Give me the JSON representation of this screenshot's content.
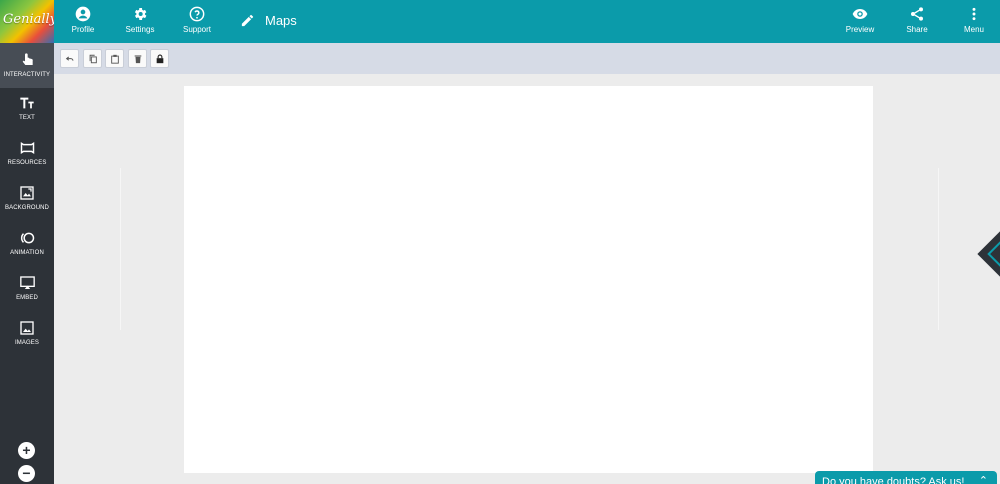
{
  "brand": {
    "logo_text": "Genially"
  },
  "topbar": {
    "profile_label": "Profile",
    "settings_label": "Settings",
    "support_label": "Support",
    "title": "Maps",
    "preview_label": "Preview",
    "share_label": "Share",
    "menu_label": "Menu"
  },
  "sidebar": {
    "items": [
      {
        "label": "INTERACTIVITY",
        "icon": "touch-icon"
      },
      {
        "label": "TEXT",
        "icon": "text-icon"
      },
      {
        "label": "RESOURCES",
        "icon": "resources-icon"
      },
      {
        "label": "BACKGROUND",
        "icon": "background-icon"
      },
      {
        "label": "ANIMATION",
        "icon": "animation-icon"
      },
      {
        "label": "EMBED",
        "icon": "embed-icon"
      },
      {
        "label": "IMAGES",
        "icon": "image-icon"
      }
    ],
    "zoom_in": "+",
    "zoom_out": "−"
  },
  "toolbar": {
    "tools": [
      "undo-icon",
      "copy-icon",
      "paste-icon",
      "delete-icon",
      "lock-icon"
    ]
  },
  "help": {
    "label": "Do you have doubts? Ask us!",
    "chevron": "⌃"
  },
  "colors": {
    "accent": "#0b9baa",
    "sidebar": "#2d3238",
    "toolbar": "#d6dbe6",
    "workspace": "#ececec"
  }
}
